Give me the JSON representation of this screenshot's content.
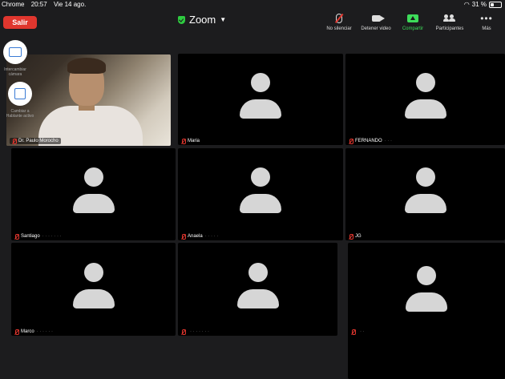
{
  "status_bar": {
    "app": "Chrome",
    "time": "20:57",
    "date": "Vie 14 ago.",
    "battery": "31 %",
    "battery_level": 0.31
  },
  "header": {
    "leave_label": "Salir",
    "title": "Zoom",
    "title_icon": "shield-check-icon",
    "toolbar": [
      {
        "id": "mute",
        "label": "No silenciar",
        "icon": "mic-muted-icon"
      },
      {
        "id": "video",
        "label": "Detener video",
        "icon": "camera-icon"
      },
      {
        "id": "share",
        "label": "Compartir",
        "icon": "share-screen-icon",
        "color": "#3ddc5a"
      },
      {
        "id": "participants",
        "label": "Participantes",
        "icon": "participants-icon"
      },
      {
        "id": "more",
        "label": "Más",
        "icon": "more-icon"
      }
    ]
  },
  "floating": [
    {
      "label": "Intercambiar cámara",
      "icon": "switch-camera-icon"
    },
    {
      "label": "Cambiar a Hablante activo",
      "icon": "active-speaker-icon"
    }
  ],
  "participants": [
    {
      "name": "Dr. Paulo Morocho",
      "video": true,
      "muted": true
    },
    {
      "name": "Maria",
      "video": false,
      "muted": true
    },
    {
      "name": "FERNANDO",
      "video": false,
      "muted": true
    },
    {
      "name": "Santiago",
      "video": false,
      "muted": true
    },
    {
      "name": "Anaela",
      "video": false,
      "muted": true
    },
    {
      "name": "JG",
      "video": false,
      "muted": true
    },
    {
      "name": "Marco",
      "video": false,
      "muted": true
    },
    {
      "name": "",
      "video": false,
      "muted": true
    },
    {
      "name": "",
      "video": false,
      "muted": true
    }
  ],
  "colors": {
    "accent": "#3ddc5a",
    "danger": "#e0362e",
    "background": "#1c1c1e"
  }
}
